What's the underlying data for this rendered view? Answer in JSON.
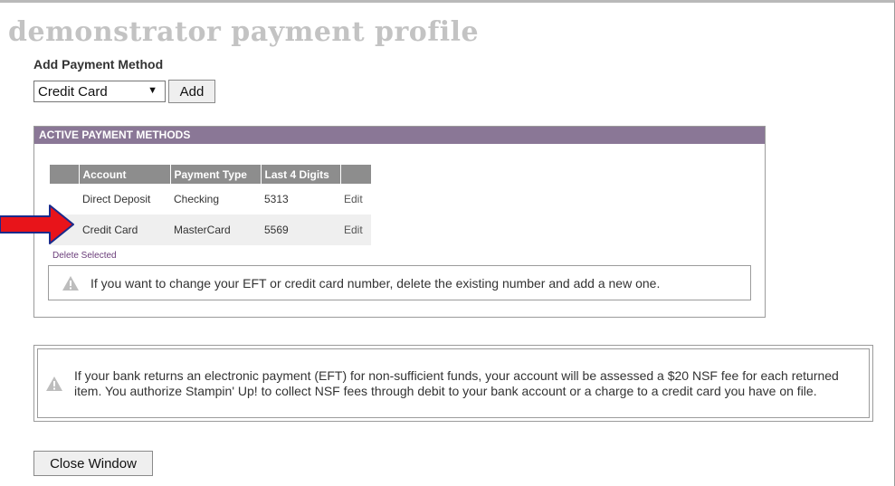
{
  "page": {
    "title": "demonstrator payment profile"
  },
  "add_method": {
    "label": "Add Payment Method",
    "select_value": "Credit Card",
    "add_label": "Add"
  },
  "active_methods": {
    "header": "ACTIVE PAYMENT METHODS",
    "columns": [
      "Account",
      "Payment Type",
      "Last 4 Digits"
    ],
    "rows": [
      {
        "account": "Direct Deposit",
        "type": "Checking",
        "last4": "5313",
        "edit": "Edit"
      },
      {
        "account": "Credit Card",
        "type": "MasterCard",
        "last4": "5569",
        "edit": "Edit"
      }
    ],
    "delete_label": "Delete Selected",
    "notice": "If you want to change your EFT or credit card number, delete the existing number and add a new one."
  },
  "nsf_notice": "If your bank returns an electronic payment (EFT) for non-sufficient funds, your account will be assessed a $20 NSF fee for each returned item.  You authorize Stampin' Up! to collect NSF fees through debit to your bank account or a charge to a credit card you have on file.",
  "footer": {
    "close_label": "Close Window"
  },
  "icons": {
    "warning": "warning-icon",
    "annotation": "arrow-right-icon"
  },
  "colors": {
    "header_bg": "#8a7796",
    "table_head_bg": "#8d8d8d",
    "link": "#6a3d7a",
    "arrow": "#e8141a"
  }
}
